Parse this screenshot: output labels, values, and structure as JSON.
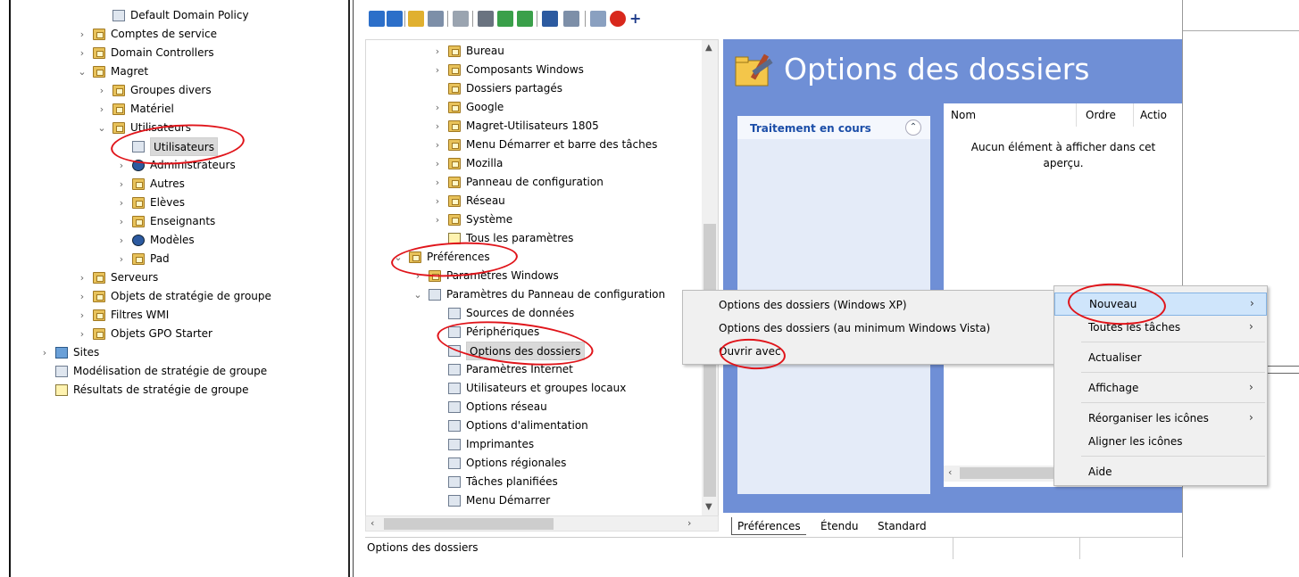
{
  "left_tree": [
    {
      "label": "Default Domain Policy",
      "icon": "gpo-link-icon",
      "indent": 2,
      "chev": ""
    },
    {
      "label": "Comptes de service",
      "icon": "ou-folder-icon",
      "indent": 1,
      "chev": "›"
    },
    {
      "label": "Domain Controllers",
      "icon": "ou-folder-icon",
      "indent": 1,
      "chev": "›"
    },
    {
      "label": "Magret",
      "icon": "ou-folder-icon",
      "indent": 1,
      "chev": "⌄"
    },
    {
      "label": "Groupes divers",
      "icon": "ou-folder-icon",
      "indent": 2,
      "chev": "›"
    },
    {
      "label": "Matériel",
      "icon": "ou-folder-icon",
      "indent": 2,
      "chev": "›"
    },
    {
      "label": "Utilisateurs",
      "icon": "ou-folder-icon",
      "indent": 2,
      "chev": "⌄"
    },
    {
      "label": "Utilisateurs",
      "icon": "gpo-link-icon",
      "indent": 3,
      "chev": "",
      "selected": true
    },
    {
      "label": "Administrateurs",
      "icon": "blocked-ou-icon",
      "indent": 3,
      "chev": "›"
    },
    {
      "label": "Autres",
      "icon": "ou-folder-icon",
      "indent": 3,
      "chev": "›"
    },
    {
      "label": "Elèves",
      "icon": "ou-folder-icon",
      "indent": 3,
      "chev": "›"
    },
    {
      "label": "Enseignants",
      "icon": "ou-folder-icon",
      "indent": 3,
      "chev": "›"
    },
    {
      "label": "Modèles",
      "icon": "blocked-ou-icon",
      "indent": 3,
      "chev": "›"
    },
    {
      "label": "Pad",
      "icon": "ou-folder-icon",
      "indent": 3,
      "chev": "›"
    },
    {
      "label": "Serveurs",
      "icon": "ou-folder-icon",
      "indent": 1,
      "chev": "›"
    },
    {
      "label": "Objets de stratégie de groupe",
      "icon": "gpo-container-icon",
      "indent": 1,
      "chev": "›"
    },
    {
      "label": "Filtres WMI",
      "icon": "wmi-filter-icon",
      "indent": 1,
      "chev": "›"
    },
    {
      "label": "Objets GPO Starter",
      "icon": "starter-gpo-icon",
      "indent": 1,
      "chev": "›"
    },
    {
      "label": "Sites",
      "icon": "sites-icon",
      "indent": 0,
      "chev": "›"
    },
    {
      "label": "Modélisation de stratégie de groupe",
      "icon": "modeling-icon",
      "indent": 0,
      "chev": ""
    },
    {
      "label": "Résultats de stratégie de groupe",
      "icon": "results-icon",
      "indent": 0,
      "chev": ""
    }
  ],
  "editor_tree": [
    {
      "label": "Bureau",
      "icon": "folder-icon",
      "indent": 1,
      "chev": "›"
    },
    {
      "label": "Composants Windows",
      "icon": "folder-icon",
      "indent": 1,
      "chev": "›"
    },
    {
      "label": "Dossiers partagés",
      "icon": "folder-icon",
      "indent": 1,
      "chev": ""
    },
    {
      "label": "Google",
      "icon": "folder-icon",
      "indent": 1,
      "chev": "›"
    },
    {
      "label": "Magret-Utilisateurs 1805",
      "icon": "folder-icon",
      "indent": 1,
      "chev": "›"
    },
    {
      "label": "Menu Démarrer et barre des tâches",
      "icon": "folder-icon",
      "indent": 1,
      "chev": "›"
    },
    {
      "label": "Mozilla",
      "icon": "folder-icon",
      "indent": 1,
      "chev": "›"
    },
    {
      "label": "Panneau de configuration",
      "icon": "folder-icon",
      "indent": 1,
      "chev": "›"
    },
    {
      "label": "Réseau",
      "icon": "folder-icon",
      "indent": 1,
      "chev": "›"
    },
    {
      "label": "Système",
      "icon": "folder-icon",
      "indent": 1,
      "chev": "›"
    },
    {
      "label": "Tous les paramètres",
      "icon": "all-settings-icon",
      "indent": 1,
      "chev": ""
    },
    {
      "label": "Préférences",
      "icon": "folder-icon",
      "indent": -1,
      "chev": "⌄"
    },
    {
      "label": "Paramètres Windows",
      "icon": "folder-icon",
      "indent": 0,
      "chev": "›"
    },
    {
      "label": "Paramètres du Panneau de configuration",
      "icon": "control-panel-icon",
      "indent": 0,
      "chev": "⌄"
    },
    {
      "label": "Sources de données",
      "icon": "data-sources-icon",
      "indent": 1,
      "chev": ""
    },
    {
      "label": "Périphériques",
      "icon": "devices-icon",
      "indent": 1,
      "chev": ""
    },
    {
      "label": "Options des dossiers",
      "icon": "folder-options-icon",
      "indent": 1,
      "chev": "",
      "selected": true
    },
    {
      "label": "Paramètres Internet",
      "icon": "internet-settings-icon",
      "indent": 1,
      "chev": ""
    },
    {
      "label": "Utilisateurs et groupes locaux",
      "icon": "local-users-icon",
      "indent": 1,
      "chev": ""
    },
    {
      "label": "Options réseau",
      "icon": "network-options-icon",
      "indent": 1,
      "chev": ""
    },
    {
      "label": "Options d'alimentation",
      "icon": "power-options-icon",
      "indent": 1,
      "chev": ""
    },
    {
      "label": "Imprimantes",
      "icon": "printers-icon",
      "indent": 1,
      "chev": ""
    },
    {
      "label": "Options régionales",
      "icon": "regional-options-icon",
      "indent": 1,
      "chev": ""
    },
    {
      "label": "Tâches planifiées",
      "icon": "scheduled-tasks-icon",
      "indent": 1,
      "chev": ""
    },
    {
      "label": "Menu Démarrer",
      "icon": "start-menu-icon",
      "indent": 1,
      "chev": ""
    }
  ],
  "toolbar_icons": [
    "back-arrow-icon",
    "forward-arrow-icon",
    "up-folder-icon",
    "show-hide-tree-icon",
    "properties-icon",
    "print-icon",
    "refresh-icon",
    "export-icon",
    "help-icon",
    "show-action-pane-icon",
    "new-item-icon",
    "delete-icon",
    "add-icon"
  ],
  "details": {
    "title": "Options des dossiers",
    "task_panel_title": "Traitement en cours",
    "columns": [
      "Nom",
      "Ordre",
      "Actio"
    ],
    "empty_message": "Aucun élément à afficher dans cet aperçu."
  },
  "tabs": [
    "Préférences",
    "Étendu",
    "Standard"
  ],
  "status": "Options des dossiers",
  "submenu": {
    "items": [
      "Options des dossiers (Windows XP)",
      "Options des dossiers (au minimum Windows Vista)",
      "Ouvrir avec"
    ]
  },
  "context_menu": {
    "items": [
      {
        "label": "Nouveau",
        "submenu": true,
        "highlighted": true
      },
      {
        "label": "Toutes les tâches",
        "submenu": true
      },
      {
        "label": "Actualiser",
        "submenu": false
      },
      {
        "label": "Affichage",
        "submenu": true
      },
      {
        "label": "Réorganiser les icônes",
        "submenu": true
      },
      {
        "label": "Aligner les icônes",
        "submenu": false
      },
      {
        "label": "Aide",
        "submenu": false
      }
    ],
    "submenu_arrow": "›"
  },
  "colors": {
    "details_background": "#6f8fd6",
    "task_title": "#1c4ea8",
    "annotation": "#e0141a",
    "menu_highlight": "#cfe5fb"
  }
}
